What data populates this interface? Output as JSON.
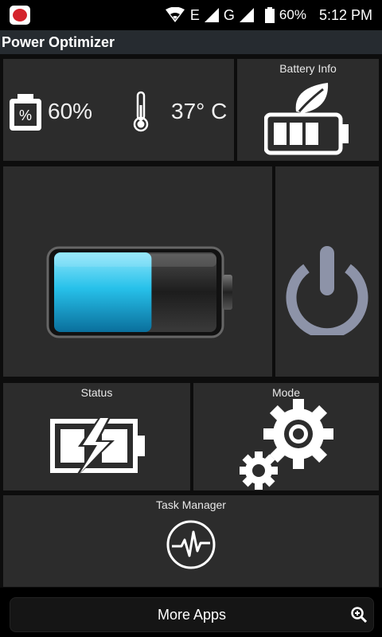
{
  "status_bar": {
    "network_e": "E",
    "network_g": "G",
    "battery": "60%",
    "time": "5:12 PM"
  },
  "header": {
    "title": "Power Optimizer"
  },
  "stats": {
    "battery_percent": "60%",
    "temperature": "37° C"
  },
  "tiles": {
    "battery_info": "Battery Info",
    "status": "Status",
    "mode": "Mode",
    "task_manager": "Task Manager"
  },
  "battery_graphic": {
    "level": 0.6
  },
  "footer": {
    "more_apps": "More Apps"
  },
  "colors": {
    "tile_bg": "#2c2c2c",
    "accent_cyan": "#2fc6ec",
    "power_icon": "#8d93a8"
  }
}
